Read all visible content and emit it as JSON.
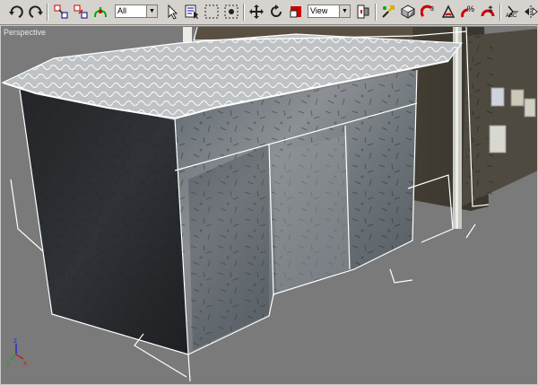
{
  "toolbar": {
    "selection_filter": "All",
    "reference_coord": "View",
    "abc_label": "ABC"
  },
  "viewport": {
    "label": "Perspective"
  },
  "colors": {
    "viewport_bg": "#7a7a7a",
    "toolbar_bg": "#d6d3ce",
    "wireframe": "#ffffff"
  }
}
